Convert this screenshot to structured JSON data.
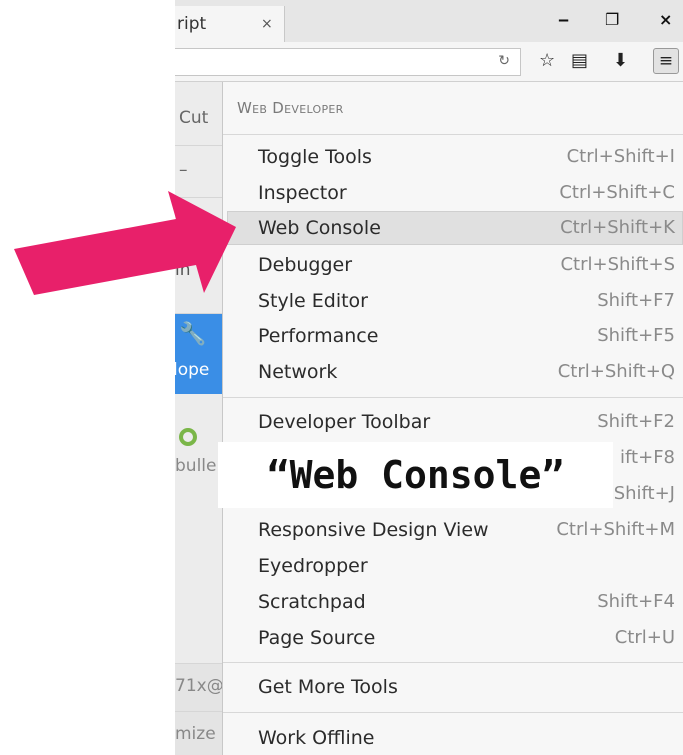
{
  "browser": {
    "tab_title": "ript",
    "tab_close": "×",
    "window_controls": {
      "minimize": "‒",
      "restore": "❐",
      "close": "×"
    },
    "reload_icon": "reload-icon",
    "toolbar_icons": [
      "bookmark-star-icon",
      "reading-list-icon",
      "download-icon",
      "hamburger-menu-icon"
    ]
  },
  "main_panel": {
    "items": [
      {
        "label": "Cut"
      },
      {
        "label": "–"
      },
      {
        "label": ""
      },
      {
        "label": "in"
      },
      {
        "label": "lope"
      },
      {
        "label": "bulle"
      },
      {
        "label": "71x@"
      },
      {
        "label": "mize"
      }
    ]
  },
  "submenu": {
    "title": "Web Developer",
    "groups": [
      [
        {
          "label": "Toggle Tools",
          "shortcut": "Ctrl+Shift+I"
        },
        {
          "label": "Inspector",
          "shortcut": "Ctrl+Shift+C"
        },
        {
          "label": "Web Console",
          "shortcut": "Ctrl+Shift+K",
          "highlighted": true
        },
        {
          "label": "Debugger",
          "shortcut": "Ctrl+Shift+S"
        },
        {
          "label": "Style Editor",
          "shortcut": "Shift+F7"
        },
        {
          "label": "Performance",
          "shortcut": "Shift+F5"
        },
        {
          "label": "Network",
          "shortcut": "Ctrl+Shift+Q"
        }
      ],
      [
        {
          "label": "Developer Toolbar",
          "shortcut": "Shift+F2"
        },
        {
          "label": "",
          "shortcut": "ift+F8"
        },
        {
          "label": "",
          "shortcut": "Shift+J"
        },
        {
          "label": "Responsive Design View",
          "shortcut": "Ctrl+Shift+M"
        },
        {
          "label": "Eyedropper",
          "shortcut": ""
        },
        {
          "label": "Scratchpad",
          "shortcut": "Shift+F4"
        },
        {
          "label": "Page Source",
          "shortcut": "Ctrl+U"
        }
      ],
      [
        {
          "label": "Get More Tools",
          "shortcut": ""
        }
      ],
      [
        {
          "label": "Work Offline",
          "shortcut": ""
        }
      ]
    ]
  },
  "annotation": {
    "caption": "“Web Console”",
    "arrow_color": "#e8206a"
  }
}
